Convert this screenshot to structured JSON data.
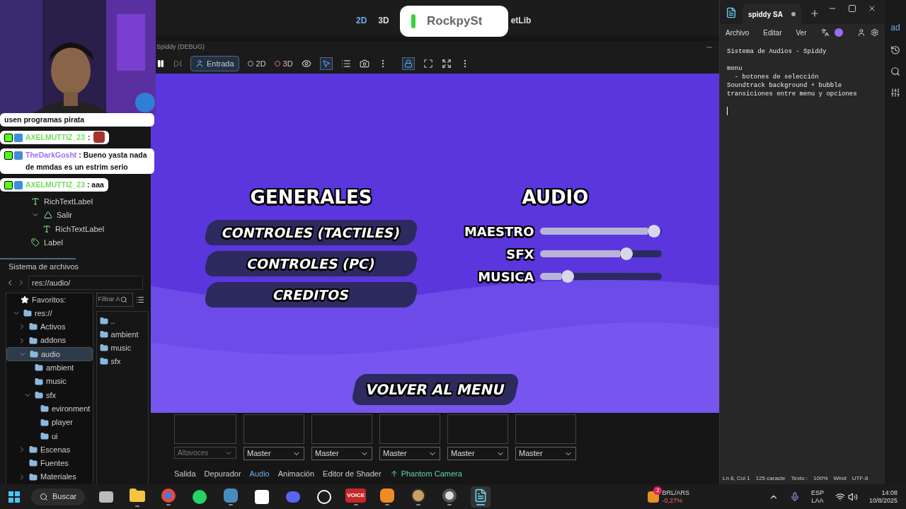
{
  "editor": {
    "main_tabs": [
      {
        "label": "2D",
        "selected": true
      },
      {
        "label": "3D",
        "selected": false
      },
      {
        "label": "etLib",
        "selected": false
      }
    ],
    "scene_tree": [
      {
        "label": "RichTextLabel",
        "kind": "rich_text"
      },
      {
        "label": "Salir",
        "kind": "button",
        "expanded": true,
        "children": [
          {
            "label": "RichTextLabel",
            "kind": "rich_text"
          }
        ]
      },
      {
        "label": "Label",
        "kind": "label"
      }
    ],
    "filesystem": {
      "title": "Sistema de archivos",
      "path": "res://audio/",
      "favorites": "Favoritos:",
      "filter_placeholder": "Filtrar A",
      "tree": [
        {
          "label": "res://",
          "expanded": true,
          "selected": false,
          "children": [
            {
              "label": "Activos",
              "expanded": false,
              "selected": false
            },
            {
              "label": "addons",
              "expanded": false,
              "selected": false
            },
            {
              "label": "audio",
              "expanded": true,
              "selected": true,
              "children": [
                {
                  "label": "ambient",
                  "selected": false
                },
                {
                  "label": "music",
                  "selected": false
                },
                {
                  "label": "sfx",
                  "expanded": true,
                  "selected": false,
                  "children": [
                    {
                      "label": "evironment",
                      "selected": false
                    },
                    {
                      "label": "player",
                      "selected": false
                    },
                    {
                      "label": "ui",
                      "selected": false
                    }
                  ]
                }
              ]
            },
            {
              "label": "Escenas",
              "expanded": false,
              "selected": false
            },
            {
              "label": "Fuentes",
              "selected": false
            },
            {
              "label": "Materiales",
              "expanded": false,
              "selected": false
            }
          ]
        }
      ],
      "files": [
        "..",
        "ambient",
        "music",
        "sfx"
      ]
    },
    "audio_buses": {
      "first_select": "Altavoces",
      "selects": [
        "Master",
        "Master",
        "Master",
        "Master",
        "Master"
      ]
    },
    "bottom_tabs": [
      {
        "label": "Salida",
        "selected": false
      },
      {
        "label": "Depurador",
        "selected": false
      },
      {
        "label": "Audio",
        "selected": true
      },
      {
        "label": "Animación",
        "selected": false
      },
      {
        "label": "Editor de Shader",
        "selected": false
      },
      {
        "label": "Phantom Camera",
        "selected": false,
        "kind": "plugin"
      }
    ],
    "inspector_fragment": "ad"
  },
  "game_window": {
    "title": "Spiddy (DEBUG)",
    "input_label": "Entrada",
    "mode_2d": "2D",
    "mode_3d": "3D",
    "generales": {
      "title": "GENERALES",
      "buttons": [
        "CONTROLES (TACTILES)",
        "CONTROLES (PC)",
        "CREDITOS"
      ]
    },
    "audio": {
      "title": "AUDIO",
      "sliders": [
        {
          "name": "MAESTRO",
          "level": 0.94
        },
        {
          "name": "SFX",
          "level": 0.71
        },
        {
          "name": "MUSICA",
          "level": 0.23
        }
      ]
    },
    "back_button": "VOLVER AL MENU"
  },
  "chat": [
    {
      "kind": "continuation",
      "text": "usen programas pirata"
    },
    {
      "kind": "emote",
      "user": "AXELMUTTIZ_23",
      "color": "#6fe05a",
      "separator": ":"
    },
    {
      "kind": "message",
      "user": "TheDarkGosht",
      "color": "#a46bff",
      "separator": ":",
      "text": "Bueno yasta nada de mmdas es un estrim serio"
    },
    {
      "kind": "message",
      "user": "AXELMUTTIZ_23",
      "color": "#6fe05a",
      "separator": ":",
      "text": "aaa"
    }
  ],
  "toast": {
    "text": "RockpySt"
  },
  "notepad": {
    "tab": "spiddy SA",
    "unsaved": true,
    "menu": [
      "Archivo",
      "Editar",
      "Ver"
    ],
    "paragraphs": [
      [
        "Sistema de Audios - Spiddy"
      ],
      [
        "menu",
        "  - botones de selección",
        "Soundtrack background + bubble",
        "transiciones entre menu y opciones"
      ]
    ],
    "status": [
      "Ln 8, Col 1",
      "125 caracte",
      "Texto :",
      "100%",
      "Wind",
      "UTF-8"
    ]
  },
  "taskbar": {
    "search": "Buscar",
    "apps": [
      {
        "kind": "taskview",
        "active": false,
        "selected": false
      },
      {
        "kind": "folder",
        "active": true,
        "selected": false
      },
      {
        "kind": "chrome",
        "active": true,
        "selected": false
      },
      {
        "kind": "whatsapp",
        "active": false,
        "selected": false
      },
      {
        "kind": "godot",
        "active": true,
        "selected": false
      },
      {
        "kind": "w",
        "active": false,
        "selected": false
      },
      {
        "kind": "discord",
        "active": false,
        "selected": false
      },
      {
        "kind": "chatgpt",
        "active": false,
        "selected": false
      },
      {
        "kind": "voicemeeter",
        "label": "VOICE",
        "active": true,
        "selected": false
      },
      {
        "kind": "fl",
        "active": true,
        "selected": false
      },
      {
        "kind": "obs",
        "active": true,
        "selected": false
      },
      {
        "kind": "player",
        "active": true,
        "selected": false
      },
      {
        "kind": "notepad",
        "active": true,
        "selected": true
      }
    ],
    "stock": {
      "badge": "2",
      "name": "BRL/ARS",
      "change": "-0,27%"
    },
    "lang": "ESP",
    "layout": "LAA",
    "time": "14:08",
    "date": "10/8/2025"
  }
}
